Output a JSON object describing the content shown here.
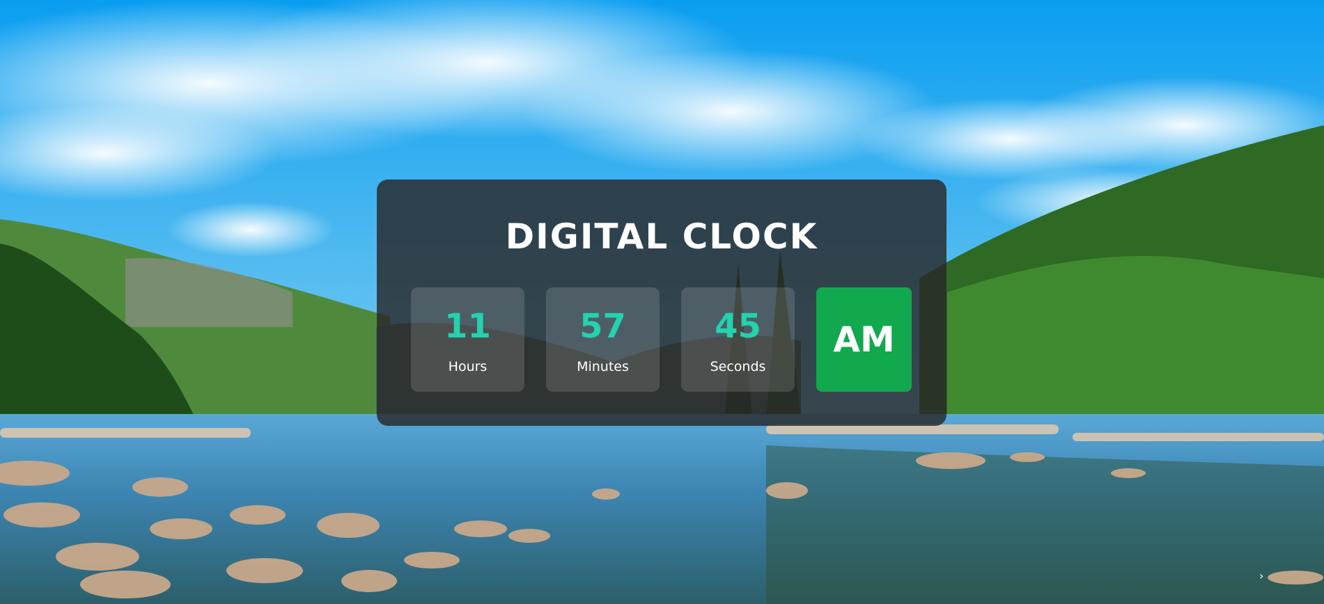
{
  "clock": {
    "title": "DIGITAL CLOCK",
    "hours": {
      "value": "11",
      "label": "Hours"
    },
    "minutes": {
      "value": "57",
      "label": "Minutes"
    },
    "seconds": {
      "value": "45",
      "label": "Seconds"
    },
    "period": "AM"
  },
  "background": {
    "description_icon": "lake-landscape-image",
    "colors": {
      "sky": "#0aa0ee",
      "cloud": "#ffffff",
      "forest": "#2f6b22",
      "water": "#3f8fb8"
    }
  },
  "colors": {
    "card_bg": "#282828",
    "number": "#23d2ae",
    "label": "#ffffff",
    "ampm_bg": "#12a84e"
  },
  "corner_icon": "chevron-right-icon"
}
